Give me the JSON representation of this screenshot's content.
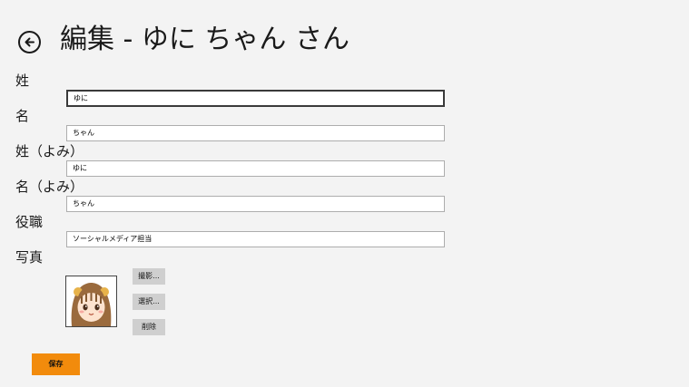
{
  "header": {
    "title": "編集 - ゆに ちゃん さん",
    "back_icon": "back-arrow-icon"
  },
  "form": {
    "last_name": {
      "label": "姓",
      "value": "ゆに"
    },
    "first_name": {
      "label": "名",
      "value": "ちゃん"
    },
    "last_name_kana": {
      "label": "姓（よみ）",
      "value": "ゆに"
    },
    "first_name_kana": {
      "label": "名（よみ）",
      "value": "ちゃん"
    },
    "job_title": {
      "label": "役職",
      "value": "ソーシャルメディア担当"
    },
    "photo": {
      "label": "写真",
      "capture_label": "撮影...",
      "select_label": "選択...",
      "delete_label": "削除"
    }
  },
  "actions": {
    "save_label": "保存"
  },
  "colors": {
    "accent": "#f28b0c",
    "background": "#f3f3f3",
    "button_gray": "#cfcfcf"
  }
}
